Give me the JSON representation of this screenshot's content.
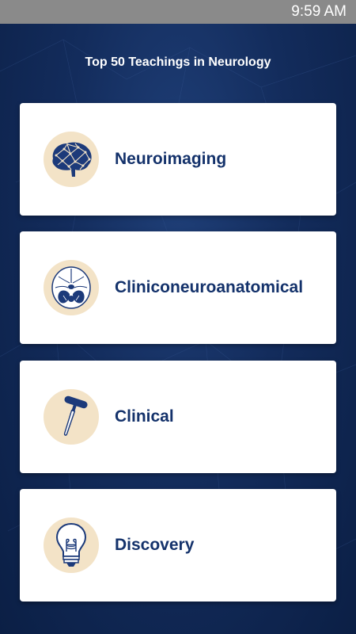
{
  "status_bar": {
    "time": "9:59 AM"
  },
  "header": {
    "title": "Top 50 Teachings in Neurology"
  },
  "categories": [
    {
      "label": "Neuroimaging",
      "icon": "brain-icon"
    },
    {
      "label": "Cliniconeuroanatomical",
      "icon": "skull-base-icon"
    },
    {
      "label": "Clinical",
      "icon": "reflex-hammer-icon"
    },
    {
      "label": "Discovery",
      "icon": "lightbulb-icon"
    }
  ],
  "colors": {
    "background": "#132c5c",
    "card": "#ffffff",
    "label": "#14326b",
    "icon_circle": "#f3e3c7",
    "icon_stroke": "#1c3a7a"
  }
}
